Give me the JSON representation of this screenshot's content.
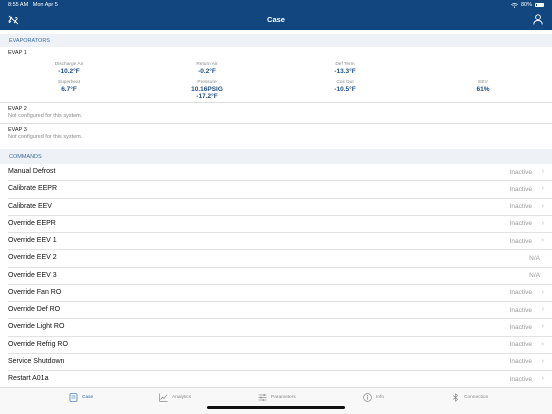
{
  "status_bar": {
    "time": "8:55 AM",
    "date": "Mon Apr 5",
    "battery": "80%"
  },
  "nav": {
    "title": "Case",
    "left_icon": "link-off-icon",
    "right_icon": "user-icon"
  },
  "evaporators": {
    "header": "EVAPORATORS",
    "evap1": {
      "title": "EVAP 1",
      "metrics": [
        {
          "label": "Discharge Air",
          "value": "-10.2°F"
        },
        {
          "label": "Return Air",
          "value": "-0.2°F"
        },
        {
          "label": "Def Term",
          "value": "-13.3°F"
        },
        {
          "label": "Superheat",
          "value": "6.7°F"
        },
        {
          "label": "Pressure",
          "value": "10.16PSIG",
          "value2": "-17.2°F"
        },
        {
          "label": "Coil Out",
          "value": "-10.5°F"
        },
        {
          "label": "EEV",
          "value": "61%"
        }
      ]
    },
    "evap2": {
      "title": "EVAP 2",
      "note": "Not configured for this system."
    },
    "evap3": {
      "title": "EVAP 3",
      "note": "Not configured for this system."
    }
  },
  "commands": {
    "header": "COMMANDS",
    "items": [
      {
        "label": "Manual Defrost",
        "status": "Inactive",
        "chevron": true
      },
      {
        "label": "Calibrate EEPR",
        "status": "Inactive",
        "chevron": true
      },
      {
        "label": "Calibrate EEV",
        "status": "Inactive",
        "chevron": true
      },
      {
        "label": "Override EEPR",
        "status": "Inactive",
        "chevron": true
      },
      {
        "label": "Override EEV 1",
        "status": "Inactive",
        "chevron": true
      },
      {
        "label": "Override EEV 2",
        "status": "N/A",
        "chevron": false
      },
      {
        "label": "Override EEV 3",
        "status": "N/A",
        "chevron": false
      },
      {
        "label": "Override Fan RO",
        "status": "Inactive",
        "chevron": true
      },
      {
        "label": "Override Def RO",
        "status": "Inactive",
        "chevron": true
      },
      {
        "label": "Override Light RO",
        "status": "Inactive",
        "chevron": true
      },
      {
        "label": "Override Refrig RO",
        "status": "Inactive",
        "chevron": true
      },
      {
        "label": "Service Shutdown",
        "status": "Inactive",
        "chevron": true
      },
      {
        "label": "Restart A01a",
        "status": "Inactive",
        "chevron": true
      }
    ]
  },
  "tabbar": {
    "tabs": [
      {
        "label": "Case",
        "icon": "case-icon",
        "active": true
      },
      {
        "label": "Analytics",
        "icon": "chart-icon",
        "active": false
      },
      {
        "label": "Parameters",
        "icon": "sliders-icon",
        "active": false
      },
      {
        "label": "Info",
        "icon": "info-icon",
        "active": false
      },
      {
        "label": "Connection",
        "icon": "bluetooth-icon",
        "active": false
      }
    ]
  },
  "colors": {
    "header_bg": "#12467e",
    "accent": "#1f4f86",
    "section_text": "#3d6e9f",
    "tab_active": "#2f6fb5"
  }
}
